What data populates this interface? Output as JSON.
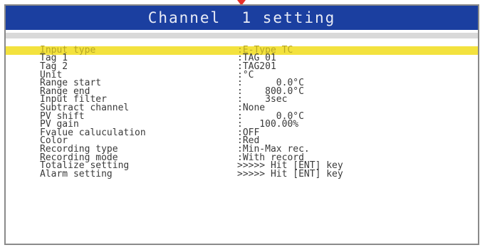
{
  "title": "Channel  1 setting",
  "rows": [
    {
      "label": "Input type",
      "value": ":E-Type TC",
      "selected": true
    },
    {
      "label": "Tag 1",
      "value": ":TAG 01"
    },
    {
      "label": "Tag 2",
      "value": ":TAG201"
    },
    {
      "label": "Unit",
      "value": ":°C"
    },
    {
      "label": "Range start",
      "value": ":      0.0°C"
    },
    {
      "label": "Range end",
      "value": ":    800.0°C"
    },
    {
      "label": "Input filter",
      "value": ":    3sec"
    },
    {
      "label": "Subtract channel",
      "value": ":None"
    },
    {
      "label": "PV shift",
      "value": ":      0.0°C"
    },
    {
      "label": "PV gain",
      "value": ":   100.00%"
    },
    {
      "label": "Fvalue caluculation",
      "value": ":OFF"
    },
    {
      "label": "Color",
      "value": ":Red"
    },
    {
      "label": "Recording type",
      "value": ":Min-Max rec."
    },
    {
      "label": "Recording mode",
      "value": ":With record"
    },
    {
      "label": "Totalize setting",
      "value": ">>>>> Hit [ENT] key"
    },
    {
      "label": "Alarm setting",
      "value": ">>>>> Hit [ENT] key"
    }
  ],
  "colors": {
    "title_bar": "#1b3fa0",
    "highlight": "#f3e23e",
    "text": "#3a3a3a",
    "pointer": "#e8322a"
  }
}
